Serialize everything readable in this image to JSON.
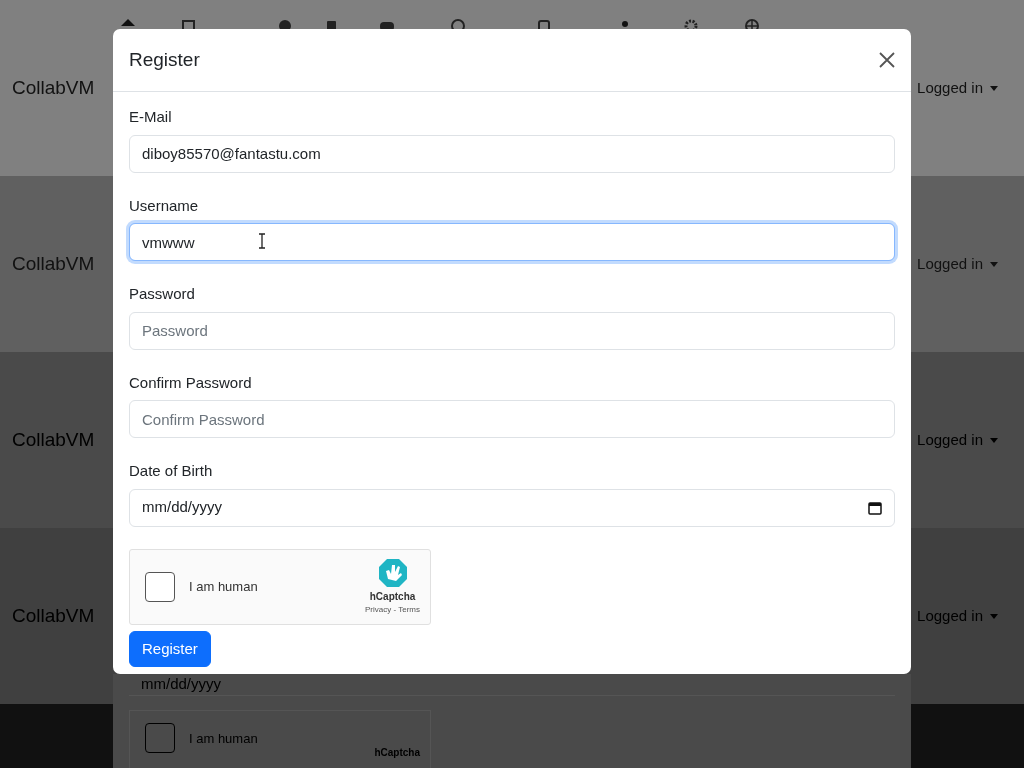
{
  "bands": [
    {
      "brand": "CollabVM",
      "user_menu": "Logged in"
    },
    {
      "brand": "CollabVM",
      "user_menu": "Logged in"
    },
    {
      "brand": "CollabVM",
      "user_menu": "Logged in"
    },
    {
      "brand": "CollabVM",
      "user_menu": "Logged in"
    }
  ],
  "modal": {
    "title": "Register",
    "fields": [
      {
        "kind": "text",
        "label": "E-Mail",
        "value": "diboy85570@fantastu.com",
        "focused": false
      },
      {
        "kind": "text",
        "label": "Username",
        "value": "vmwww",
        "focused": true
      },
      {
        "kind": "password",
        "label": "Password",
        "placeholder": "Password",
        "focused": false
      },
      {
        "kind": "password",
        "label": "Confirm Password",
        "placeholder": "Confirm Password",
        "focused": false
      },
      {
        "kind": "date",
        "label": "Date of Birth",
        "placeholder": "mm/dd/yyyy",
        "focused": false
      }
    ],
    "captcha": {
      "checked": false,
      "label": "I am human",
      "brand": "hCaptcha",
      "links": "Privacy - Terms"
    },
    "submit": "Register"
  },
  "ghost": {
    "date_placeholder": "mm/dd/yyyy",
    "captcha_label": "I am human",
    "captcha_brand": "hCaptcha"
  }
}
